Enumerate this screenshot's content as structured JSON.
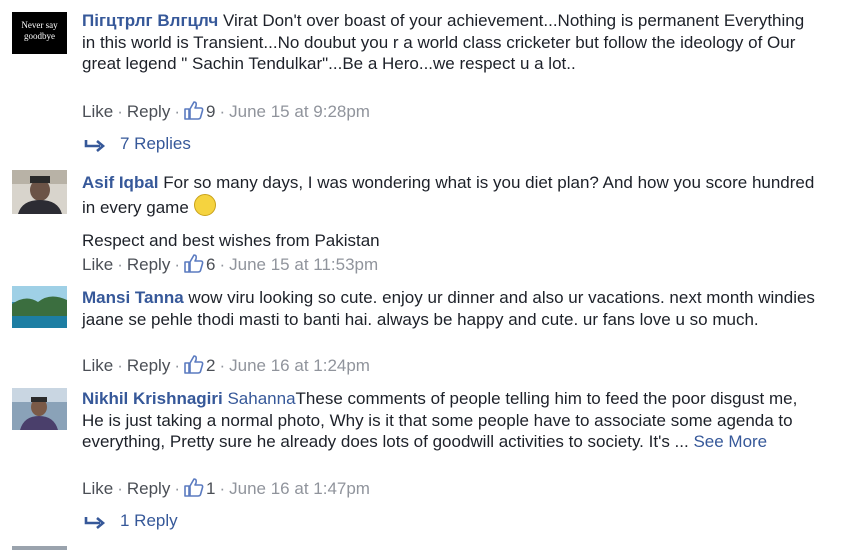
{
  "comments": [
    {
      "author": "Пігцтрлг Влгцлч",
      "avatar_lines": [
        "Never say",
        "goodbye"
      ],
      "text": " Virat Don't over boast of your achievement...Nothing is permanent Everything in this world is Transient...No doubut you r a world class cricketer but follow the ideology of Our great legend \" Sachin Tendulkar\"...Be a Hero...we respect u a lot..",
      "like_label": "Like",
      "reply_label": "Reply",
      "likes": "9",
      "time": "June 15 at 9:28pm",
      "replies_label": "7 Replies"
    },
    {
      "author": "Asif Iqbal",
      "text": " For so many days, I was wondering what is you diet plan? And how you score hundred in every game ",
      "emoji": "🙂",
      "text2": "Respect and best wishes from Pakistan",
      "like_label": "Like",
      "reply_label": "Reply",
      "likes": "6",
      "time": "June 15 at 11:53pm"
    },
    {
      "author": "Mansi Tanna",
      "text": " wow viru looking so cute. enjoy ur dinner and also ur vacations. next month windies jaane se pehle thodi masti to banti hai. always be happy and cute. ur fans love u so much.",
      "like_label": "Like",
      "reply_label": "Reply",
      "likes": "2",
      "time": "June 16 at 1:24pm"
    },
    {
      "author": "Nikhil Krishnagiri",
      "mention": " Sahanna",
      "text": "These comments of people telling him to feed the poor disgust me, He is just taking a normal photo, Why is it that some people have to associate some agenda to everything, Pretty sure he already does lots of goodwill activities to society. It's ... ",
      "see_more": "See More",
      "like_label": "Like",
      "reply_label": "Reply",
      "likes": "1",
      "time": "June 16 at 1:47pm",
      "replies_label": "1 Reply"
    }
  ],
  "colors": {
    "link": "#365899",
    "meta": "#90949c",
    "text": "#1d2129"
  },
  "icons": {
    "like": "thumbs-up-icon",
    "reply_arrow": "reply-arrow-icon"
  }
}
